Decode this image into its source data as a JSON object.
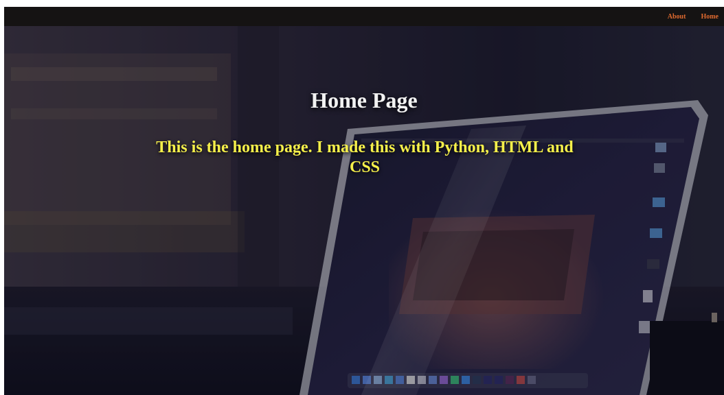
{
  "nav": {
    "links": [
      {
        "label": "About"
      },
      {
        "label": "Home"
      }
    ]
  },
  "hero": {
    "title": "Home Page",
    "subtitle": "This is the home page. I made this with Python, HTML and CSS",
    "background_image": "laptop-on-desk-photo"
  },
  "colors": {
    "navbar_bg": "#151313",
    "nav_link": "#e06a2f",
    "title": "#f2f2f2",
    "subtitle": "#f6f04a"
  }
}
